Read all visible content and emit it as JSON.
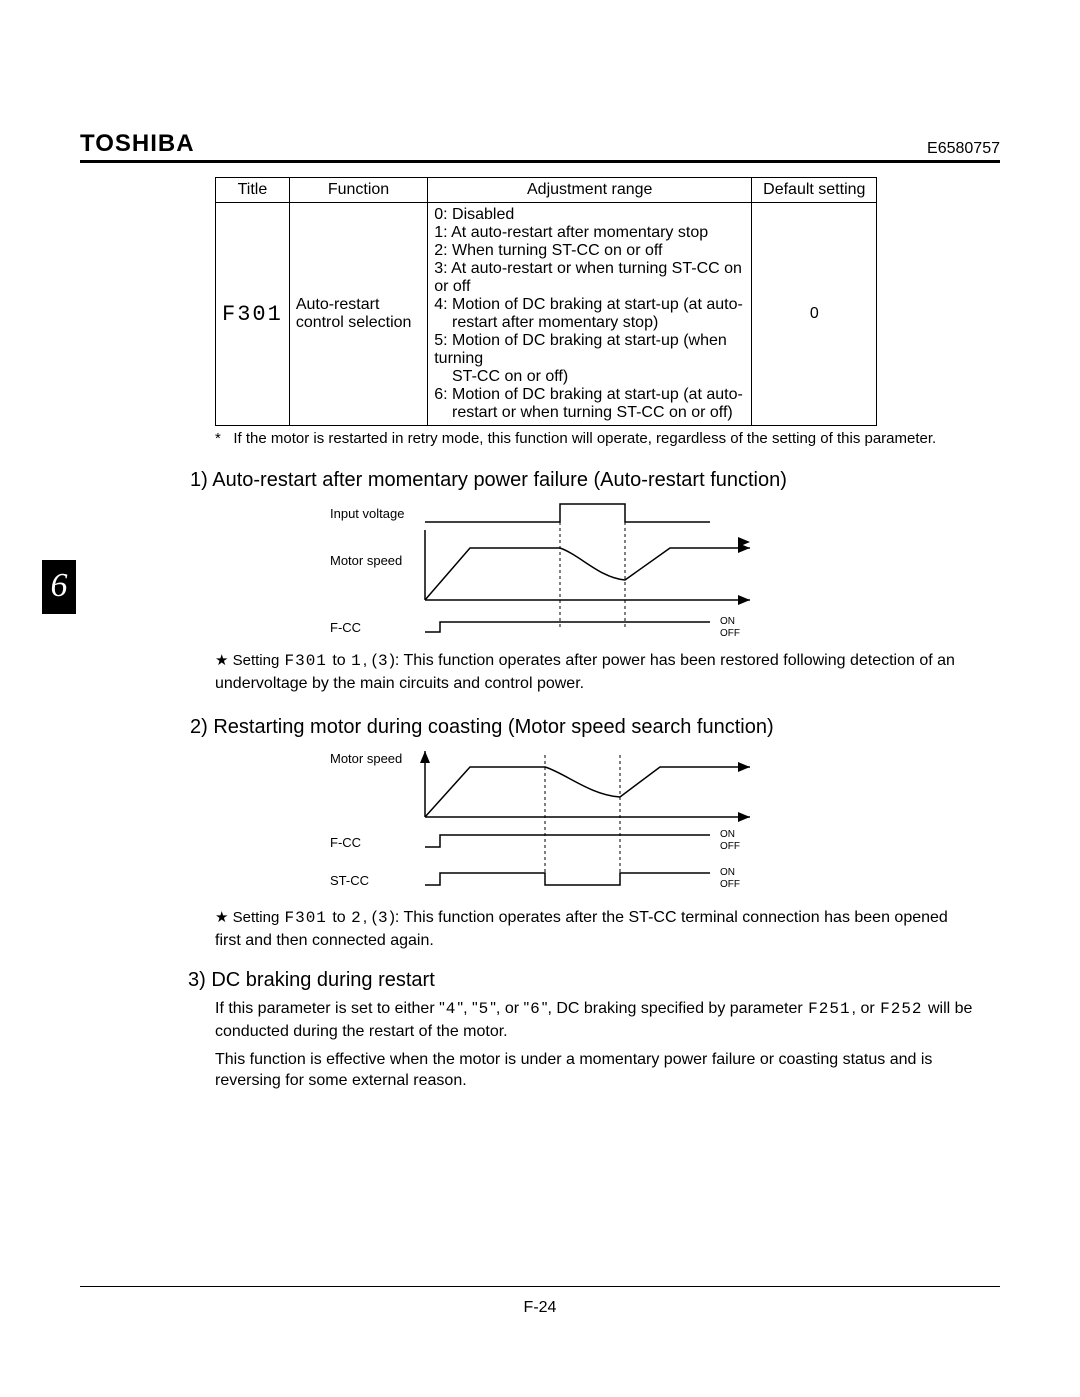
{
  "header": {
    "brand": "TOSHIBA",
    "doc_number": "E6580757"
  },
  "chapter_tab": "6",
  "table": {
    "headers": {
      "title": "Title",
      "function": "Function",
      "range": "Adjustment range",
      "default": "Default setting"
    },
    "row": {
      "title_code": "F301",
      "function": "Auto-restart control selection",
      "range_lines": [
        "0: Disabled",
        "1: At auto-restart after momentary stop",
        "2: When turning ST-CC on or off",
        "3: At auto-restart or when turning ST-CC on or off",
        "4: Motion of DC braking at start-up (at auto-",
        "    restart after momentary stop)",
        "5: Motion of DC braking at start-up (when turning",
        "    ST-CC on or off)",
        "6: Motion of DC braking at start-up (at auto-",
        "    restart or when turning ST-CC on or off)"
      ],
      "default": "0"
    },
    "footnote_mark": "*",
    "footnote": "If the motor is restarted in retry mode, this function will operate, regardless of the setting of this parameter."
  },
  "section1": {
    "heading": "1)  Auto-restart after momentary power failure (Auto-restart function)",
    "labels": {
      "input_voltage": "Input voltage",
      "motor_speed": "Motor speed",
      "fcc": "F-CC",
      "on": "ON",
      "off": "OFF"
    },
    "note_prefix": "★  Setting ",
    "note_code1": "F301",
    "note_mid1": " to ",
    "note_code2": "1",
    "note_mid2": ", (",
    "note_code3": "3",
    "note_after": "): This function operates after power has been restored following detection of an undervoltage by the main circuits and control power."
  },
  "section2": {
    "heading": "2)  Restarting motor during coasting (Motor speed search function)",
    "labels": {
      "motor_speed": "Motor speed",
      "fcc": "F-CC",
      "stcc": "ST-CC",
      "on": "ON",
      "off": "OFF"
    },
    "note_prefix": "★  Setting ",
    "note_code1": "F301",
    "note_mid1": " to ",
    "note_code2": "2",
    "note_mid2": ", (",
    "note_code3": "3",
    "note_after": "): This function operates after the ST-CC terminal connection has been opened first and then connected again."
  },
  "section3": {
    "heading": "3)  DC braking during restart",
    "line1_a": "If this parameter is set to either \"",
    "code4": "4",
    "line1_b": "\", \"",
    "code5": "5",
    "line1_c": "\", or \"",
    "code6": "6",
    "line1_d": "\", DC braking specified by parameter ",
    "code_f251": "F251",
    "line1_e": ", or ",
    "code_f252": "F252",
    "line2": " will be conducted during the restart of the motor.",
    "line3": "This function is effective when the motor is under a momentary power failure or coasting status and is reversing for some external reason."
  },
  "footer": {
    "page": "F-24"
  }
}
